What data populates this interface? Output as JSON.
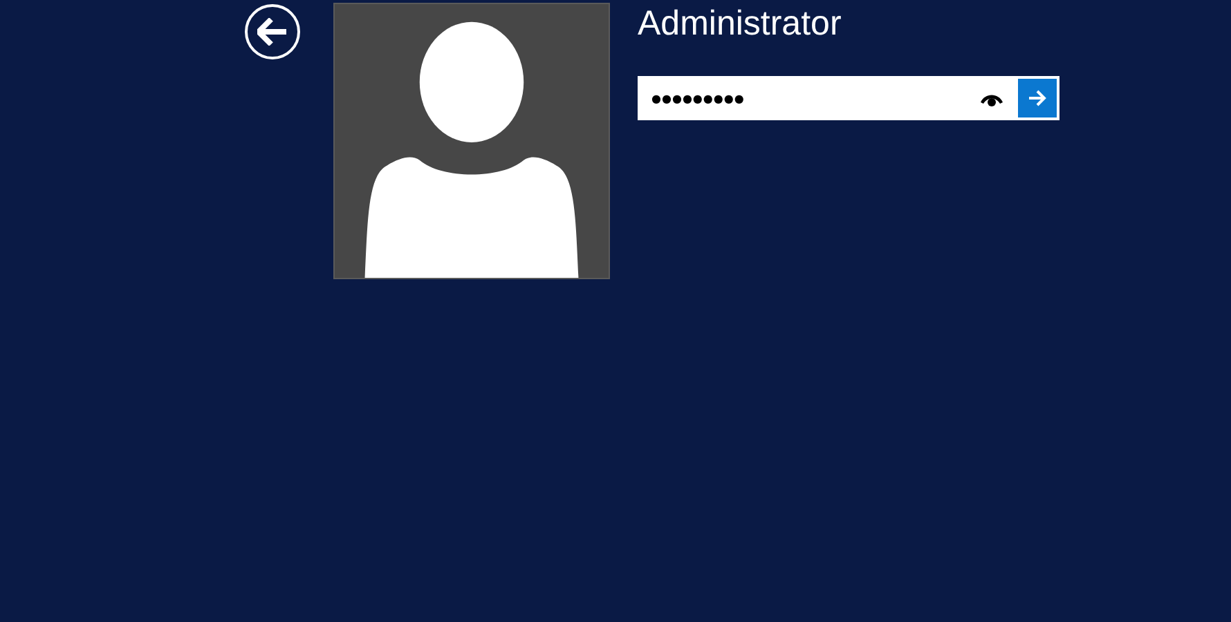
{
  "user": {
    "name": "Administrator"
  },
  "password": {
    "value": "●●●●●●●●●"
  }
}
